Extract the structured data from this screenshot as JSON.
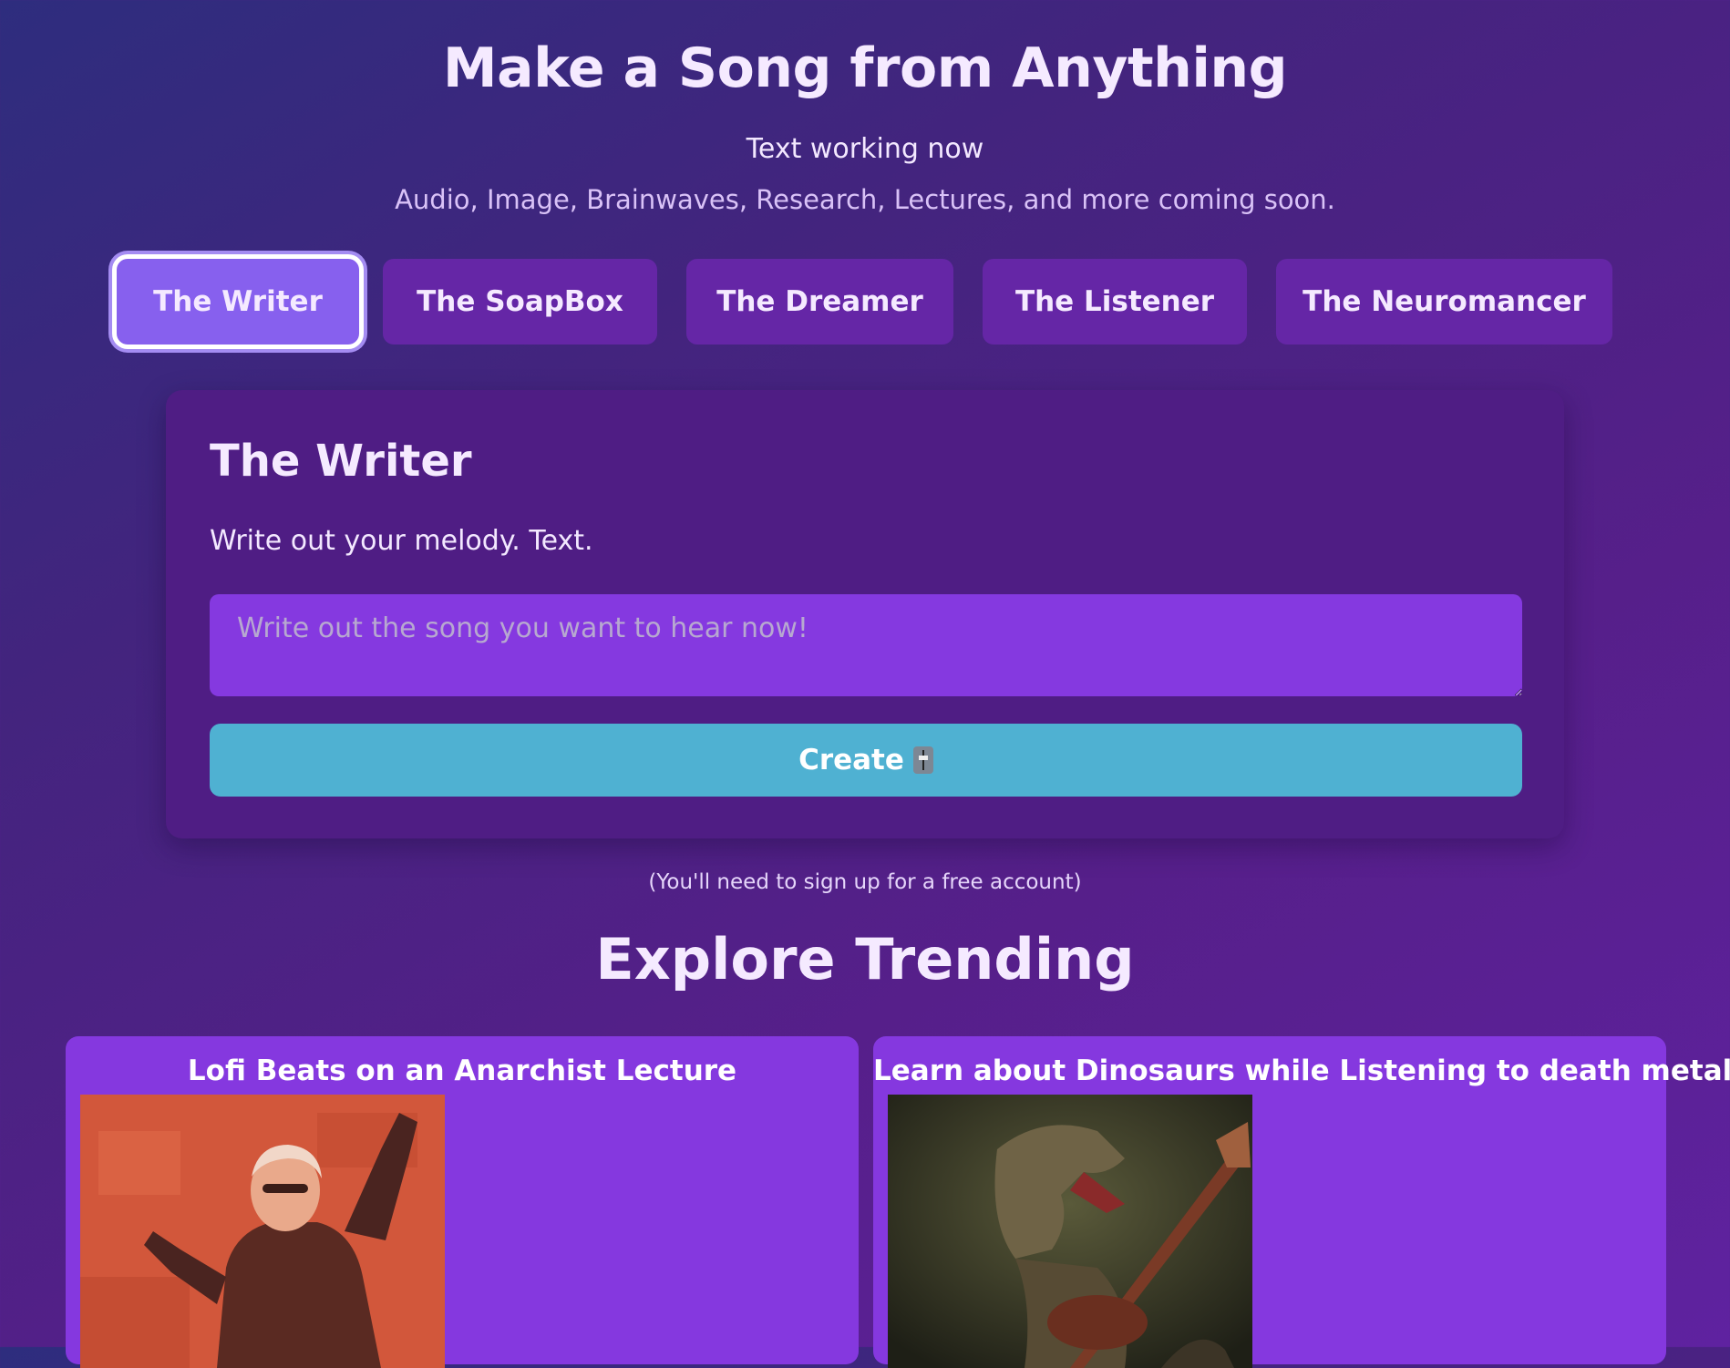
{
  "hero": {
    "title": "Make a Song from Anything",
    "subtitle": "Text working now",
    "note": "Audio, Image, Brainwaves, Research, Lectures, and more coming soon."
  },
  "tabs": [
    {
      "label": "The Writer",
      "active": true
    },
    {
      "label": "The SoapBox",
      "active": false
    },
    {
      "label": "The Dreamer",
      "active": false
    },
    {
      "label": "The Listener",
      "active": false
    },
    {
      "label": "The Neuromancer",
      "active": false
    }
  ],
  "panel": {
    "title": "The Writer",
    "description": "Write out your melody. Text.",
    "input_placeholder": "Write out the song you want to hear now!",
    "input_value": "",
    "create_label": "Create",
    "create_icon": "level-slider-icon"
  },
  "signup_note": "(You'll need to sign up for a free account)",
  "trending": {
    "title": "Explore Trending",
    "items": [
      {
        "title": "Lofi Beats on an Anarchist Lecture",
        "image": "orator-poster-illustration"
      },
      {
        "title": "Learn about Dinosaurs while Listening to death metal",
        "image": "dinosaur-guitarist-illustration"
      }
    ]
  },
  "colors": {
    "background_start": "#2e2d7e",
    "background_end": "#5f22a0",
    "tab": "#6526a6",
    "tab_active": "#8760ee",
    "panel": "#4f1d84",
    "input": "#8539e0",
    "create_button": "#4fb1d2",
    "trending_card": "#8538df"
  }
}
